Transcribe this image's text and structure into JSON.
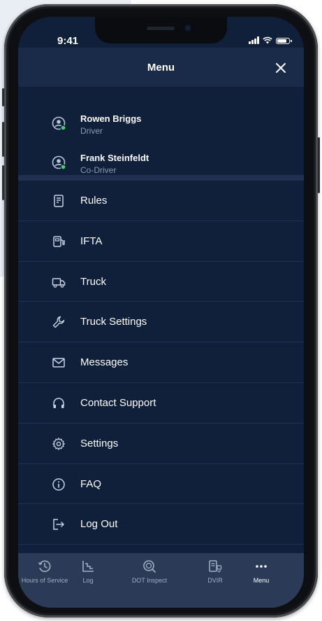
{
  "status_bar": {
    "time": "9:41"
  },
  "header": {
    "title": "Menu"
  },
  "drivers": [
    {
      "name": "Rowen Briggs",
      "role": "Driver",
      "status_color": "#3ecf6e"
    },
    {
      "name": "Frank Steinfeldt",
      "role": "Co-Driver",
      "status_color": "#3ecf6e"
    }
  ],
  "menu": {
    "items": [
      {
        "label": "Rules",
        "icon": "rules-icon"
      },
      {
        "label": "IFTA",
        "icon": "fuel-icon"
      },
      {
        "label": "Truck",
        "icon": "truck-icon"
      },
      {
        "label": "Truck Settings",
        "icon": "wrench-icon"
      },
      {
        "label": "Messages",
        "icon": "envelope-icon"
      },
      {
        "label": "Contact Support",
        "icon": "headphones-icon"
      },
      {
        "label": "Settings",
        "icon": "gear-icon"
      },
      {
        "label": "FAQ",
        "icon": "info-icon"
      },
      {
        "label": "Log Out",
        "icon": "logout-icon"
      }
    ]
  },
  "tab_bar": {
    "tabs": [
      {
        "label": "Hours of Service",
        "icon": "clock-icon",
        "active": false
      },
      {
        "label": "Log",
        "icon": "log-chart-icon",
        "active": false
      },
      {
        "label": "DOT Inspect",
        "icon": "inspect-icon",
        "active": false
      },
      {
        "label": "DVIR",
        "icon": "dvir-icon",
        "active": false
      },
      {
        "label": "Menu",
        "icon": "more-dots-icon",
        "active": true
      }
    ]
  },
  "colors": {
    "background": "#101f3a",
    "header": "#1a2b49",
    "tab_bar": "#2a3a57",
    "online_status": "#3ecf6e",
    "secondary_text": "#8d9bb2"
  }
}
